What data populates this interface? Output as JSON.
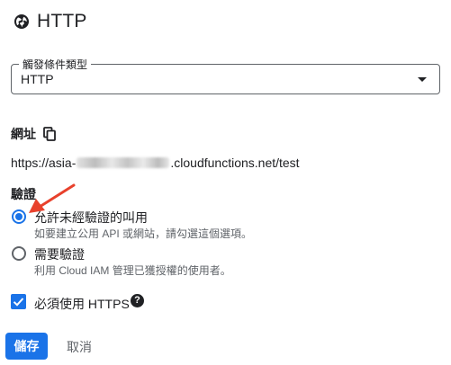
{
  "header": {
    "title": "HTTP",
    "icon": "globe-icon"
  },
  "trigger_type": {
    "label": "觸發條件類型",
    "value": "HTTP"
  },
  "url": {
    "label": "網址",
    "prefix": "https://asia-",
    "suffix": ".cloudfunctions.net/test"
  },
  "auth": {
    "label": "驗證",
    "options": [
      {
        "title": "允許未經驗證的叫用",
        "subtitle": "如要建立公用 API 或網站，請勾選這個選項。",
        "selected": true
      },
      {
        "title": "需要驗證",
        "subtitle": "利用 Cloud IAM 管理已獲授權的使用者。",
        "selected": false
      }
    ]
  },
  "https": {
    "label": "必須使用 HTTPS",
    "checked": true,
    "help_glyph": "?"
  },
  "actions": {
    "save": "儲存",
    "cancel": "取消"
  },
  "colors": {
    "accent": "#1a73e8",
    "annotation_arrow": "#e8412c"
  }
}
